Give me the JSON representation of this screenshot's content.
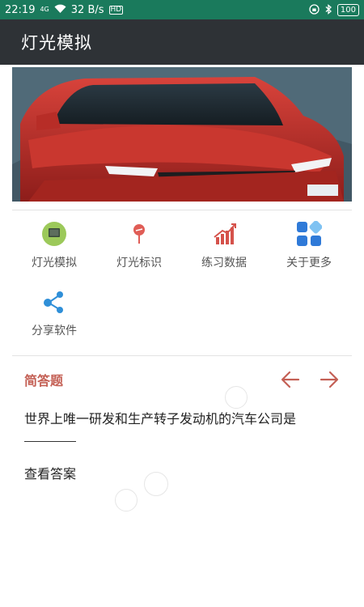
{
  "status": {
    "time": "22:19",
    "network": "4G",
    "speed": "32 B/s",
    "hd": "HD",
    "battery": "100"
  },
  "appbar": {
    "title": "灯光模拟"
  },
  "menu": {
    "items": [
      {
        "label": "灯光模拟",
        "icon": "device-icon"
      },
      {
        "label": "灯光标识",
        "icon": "map-pin-icon"
      },
      {
        "label": "练习数据",
        "icon": "chart-icon"
      },
      {
        "label": "关于更多",
        "icon": "grid-icon"
      },
      {
        "label": "分享软件",
        "icon": "share-icon"
      }
    ]
  },
  "quiz": {
    "section_title": "简答题",
    "question": "世界上唯一研发和生产转子发动机的汽车公司是",
    "view_answer": "查看答案"
  },
  "colors": {
    "statusbar": "#1a7a5c",
    "appbar": "#2e3236",
    "accent": "#c46055"
  }
}
